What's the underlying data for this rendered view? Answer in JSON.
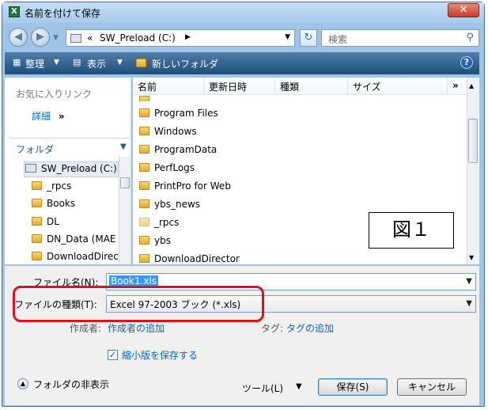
{
  "window": {
    "title": "名前を付けて保存",
    "close_glyph": "✕",
    "app_icon_letter": "X"
  },
  "nav": {
    "address_chevrons": "«",
    "address_path": "SW_Preload (C:)",
    "address_arrow": "▶",
    "search_placeholder": "検索"
  },
  "toolbar": {
    "organize": "整理",
    "view": "表示",
    "new_folder": "新しいフォルダ",
    "help": "?"
  },
  "left_pane": {
    "favorites": "お気に入りリンク",
    "details": "詳細",
    "details_glyph": "»",
    "folders_header": "フォルダ",
    "tree": [
      "SW_Preload (C:)",
      "_rpcs",
      "Books",
      "DL",
      "DN_Data (MAE",
      "DownloadDirec"
    ]
  },
  "file_pane": {
    "columns": [
      "名前",
      "更新日時",
      "種類",
      "サイズ"
    ],
    "more_glyph": "»",
    "files": [
      "Program Files",
      "Windows",
      "ProgramData",
      "PerfLogs",
      "PrintPro for Web",
      "ybs_news",
      "_rpcs",
      "ybs",
      "DownloadDirector"
    ]
  },
  "figure_label": "図１",
  "form": {
    "filename_label": "ファイル名(N):",
    "filename_value": "Book1.xls",
    "filetype_label": "ファイルの種類(T):",
    "filetype_value": "Excel 97-2003 ブック (*.xls)",
    "author_label": "作成者:",
    "author_link": "作成者の追加",
    "tags_label": "タグ:",
    "tags_link": "タグの追加",
    "thumbnail_label": "縮小版を保存する",
    "thumbnail_checked": true
  },
  "footer": {
    "hide_folders": "フォルダの非表示",
    "tools": "ツール(L)",
    "save": "保存(S)",
    "cancel": "キャンセル"
  },
  "colors": {
    "highlight": "#e0101c",
    "toolbar": "#2c5b85",
    "link": "#0066cc"
  }
}
